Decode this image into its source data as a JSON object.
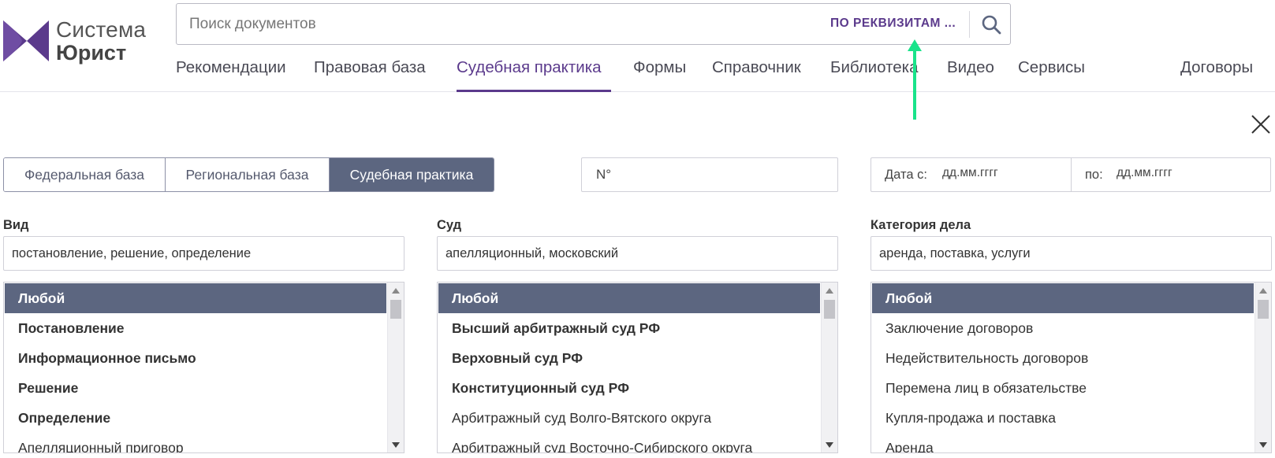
{
  "brand": {
    "line1": "Система",
    "line2": "Юрист",
    "color": "#5b3a8c"
  },
  "search": {
    "placeholder": "Поиск документов",
    "requisites_label": "ПО РЕКВИЗИТАМ ...",
    "button_icon": "search-icon"
  },
  "nav": {
    "items": [
      {
        "label": "Рекомендации"
      },
      {
        "label": "Правовая база"
      },
      {
        "label": "Судебная практика",
        "active": true
      },
      {
        "label": "Формы"
      },
      {
        "label": "Справочник"
      },
      {
        "label": "Библиотека"
      },
      {
        "label": "Видео"
      },
      {
        "label": "Сервисы"
      },
      {
        "label": "Договоры"
      }
    ]
  },
  "filters": {
    "tabs": [
      {
        "label": "Федеральная база"
      },
      {
        "label": "Региональная база"
      },
      {
        "label": "Судебная практика",
        "active": true
      }
    ],
    "number_placeholder": "N°",
    "date": {
      "from_label": "Дата с:",
      "from_placeholder": "дд.мм.гггг",
      "to_label": "по:",
      "to_placeholder": "дд.мм.гггг"
    },
    "columns": [
      {
        "label": "Вид",
        "input_value": "постановление, решение, определение",
        "items": [
          {
            "text": "Любой",
            "selected": true
          },
          {
            "text": "Постановление",
            "bold": true
          },
          {
            "text": "Информационное письмо",
            "bold": true
          },
          {
            "text": "Решение",
            "bold": true
          },
          {
            "text": "Определение",
            "bold": true
          },
          {
            "text": "Апелляционный приговор"
          }
        ]
      },
      {
        "label": "Суд",
        "input_value": "апелляционный, московский",
        "items": [
          {
            "text": "Любой",
            "selected": true
          },
          {
            "text": "Высший арбитражный суд РФ",
            "bold": true
          },
          {
            "text": "Верховный суд РФ",
            "bold": true
          },
          {
            "text": "Конституционный суд РФ",
            "bold": true
          },
          {
            "text": "Арбитражный суд Волго-Вятского округа"
          },
          {
            "text": "Арбитражный суд Восточно-Сибирского округа"
          }
        ]
      },
      {
        "label": "Категория дела",
        "input_value": "аренда, поставка, услуги",
        "items": [
          {
            "text": "Любой",
            "selected": true
          },
          {
            "text": "Заключение договоров"
          },
          {
            "text": "Недействительность договоров"
          },
          {
            "text": "Перемена лиц в обязательстве"
          },
          {
            "text": "Купля-продажа и поставка"
          },
          {
            "text": "Аренда"
          }
        ]
      }
    ]
  },
  "colors": {
    "accent": "#5b3a8c",
    "selected_bg": "#5c6680",
    "annotation_arrow": "#19e38a"
  }
}
